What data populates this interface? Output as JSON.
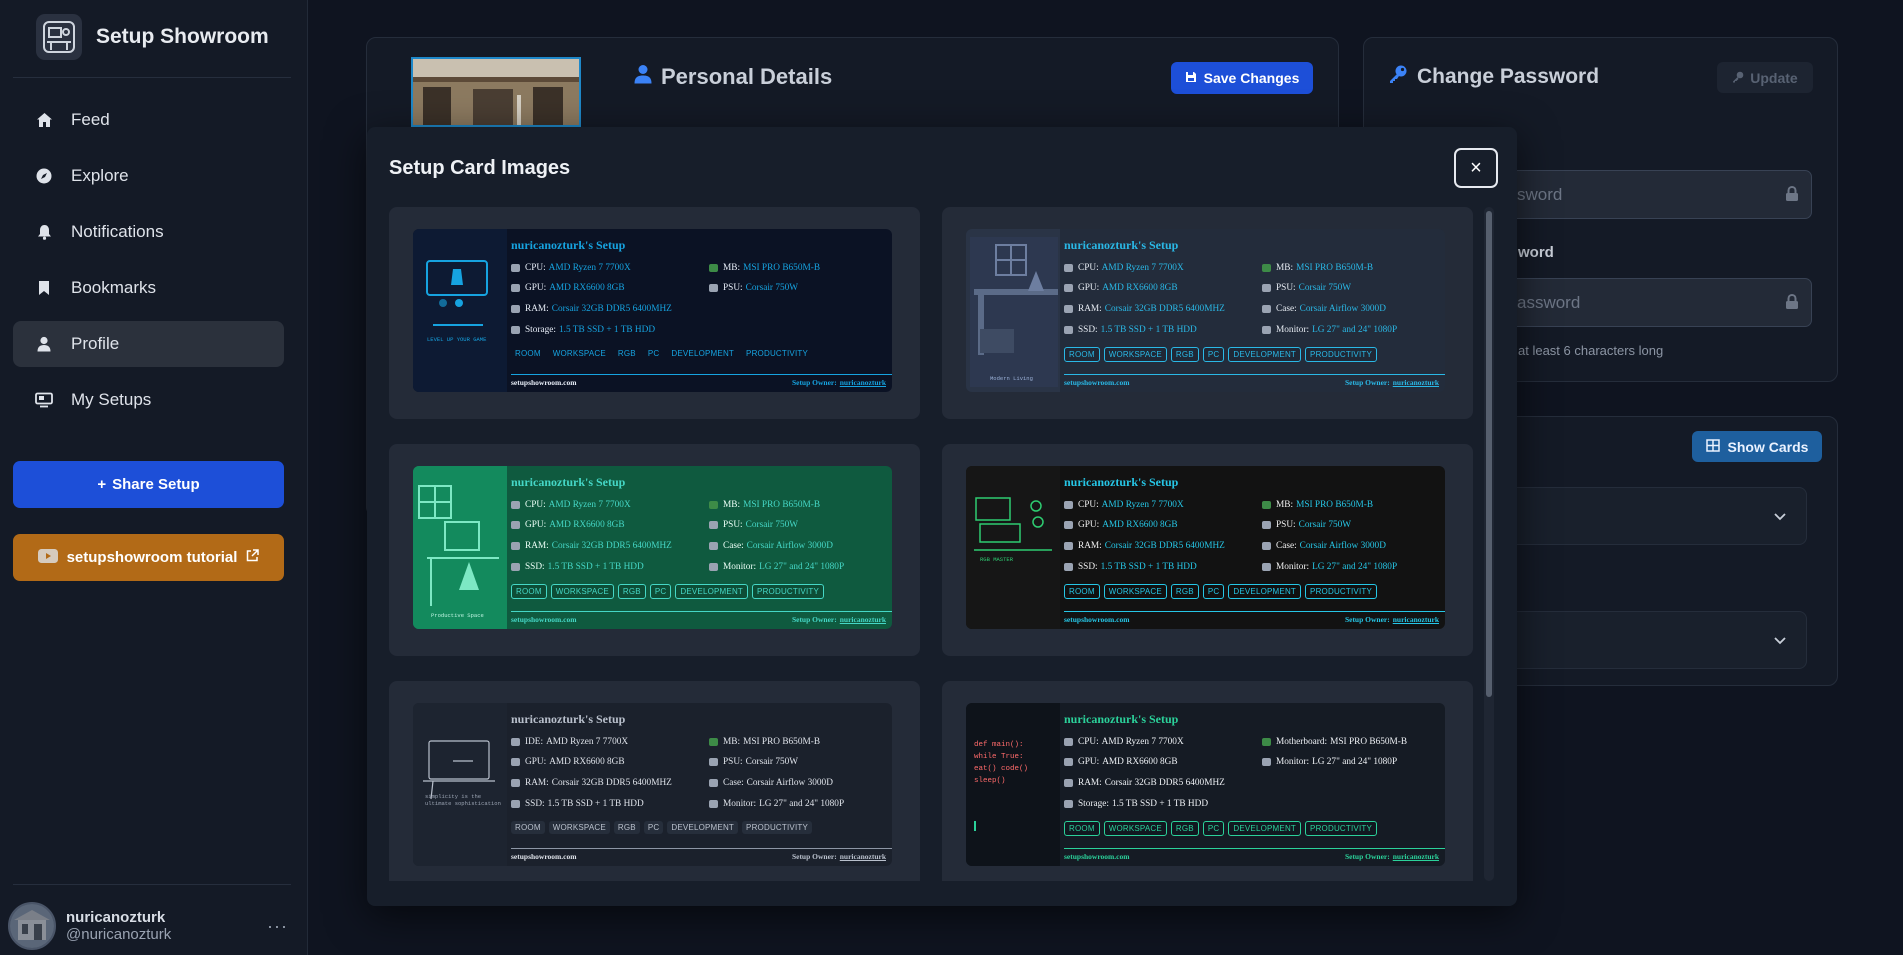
{
  "app": {
    "name": "Setup Showroom"
  },
  "sidebar": {
    "items": [
      {
        "label": "Feed",
        "icon": "home-icon"
      },
      {
        "label": "Explore",
        "icon": "compass-icon"
      },
      {
        "label": "Notifications",
        "icon": "bell-icon"
      },
      {
        "label": "Bookmarks",
        "icon": "bookmark-icon"
      },
      {
        "label": "Profile",
        "icon": "user-icon",
        "active": true
      },
      {
        "label": "My Setups",
        "icon": "monitor-icon"
      }
    ],
    "share_label": "Share Setup",
    "tutorial_label": "setupshowroom tutorial",
    "user": {
      "name": "nuricanozturk",
      "handle": "@nuricanozturk"
    }
  },
  "profile": {
    "personal_title": "Personal Details",
    "save_label": "Save Changes",
    "password_title": "Change Password",
    "update_label": "Update",
    "new_password_placeholder": "sword",
    "confirm_label": "word",
    "confirm_placeholder": "assword",
    "hint": "at least 6 characters long",
    "show_cards_label": "Show Cards"
  },
  "modal": {
    "title": "Setup Card Images",
    "close_label": "×",
    "cards": [
      {
        "theme": "dark-blue",
        "title": "nuricanozturk's Setup",
        "illustration_caption": "LEVEL UP YOUR GAME",
        "specs": [
          {
            "k": "CPU:",
            "v": "AMD Ryzen 7 7700X"
          },
          {
            "k": "MB:",
            "v": "MSI PRO B650M-B"
          },
          {
            "k": "GPU:",
            "v": "AMD RX6600 8GB"
          },
          {
            "k": "PSU:",
            "v": "Corsair 750W"
          },
          {
            "k": "RAM:",
            "v": "Corsair 32GB DDR5 6400MHZ"
          },
          {
            "k": "",
            "v": ""
          },
          {
            "k": "Storage:",
            "v": "1.5 TB SSD + 1 TB HDD"
          },
          {
            "k": "",
            "v": ""
          }
        ],
        "tags": [
          "ROOM",
          "WORKSPACE",
          "RGB",
          "PC",
          "DEVELOPMENT",
          "PRODUCTIVITY"
        ],
        "site": "setupshowroom.com",
        "owner_label": "Setup Owner:",
        "owner": "nuricanozturk"
      },
      {
        "theme": "slate",
        "title": "nuricanozturk's Setup",
        "illustration_caption": "Modern Living",
        "specs": [
          {
            "k": "CPU:",
            "v": "AMD Ryzen 7 7700X"
          },
          {
            "k": "MB:",
            "v": "MSI PRO B650M-B"
          },
          {
            "k": "GPU:",
            "v": "AMD RX6600 8GB"
          },
          {
            "k": "PSU:",
            "v": "Corsair 750W"
          },
          {
            "k": "RAM:",
            "v": "Corsair 32GB DDR5 6400MHZ"
          },
          {
            "k": "Case:",
            "v": "Corsair Airflow 3000D"
          },
          {
            "k": "SSD:",
            "v": "1.5 TB SSD + 1 TB HDD"
          },
          {
            "k": "Monitor:",
            "v": "LG 27\" and 24\" 1080P"
          }
        ],
        "tags": [
          "ROOM",
          "WORKSPACE",
          "RGB",
          "PC",
          "DEVELOPMENT",
          "PRODUCTIVITY"
        ],
        "site": "setupshowroom.com",
        "owner_label": "Setup Owner:",
        "owner": "nuricanozturk"
      },
      {
        "theme": "green",
        "title": "nuricanozturk's Setup",
        "illustration_caption": "Productive Space",
        "specs": [
          {
            "k": "CPU:",
            "v": "AMD Ryzen 7 7700X"
          },
          {
            "k": "MB:",
            "v": "MSI PRO B650M-B"
          },
          {
            "k": "GPU:",
            "v": "AMD RX6600 8GB"
          },
          {
            "k": "PSU:",
            "v": "Corsair 750W"
          },
          {
            "k": "RAM:",
            "v": "Corsair 32GB DDR5 6400MHZ"
          },
          {
            "k": "Case:",
            "v": "Corsair Airflow 3000D"
          },
          {
            "k": "SSD:",
            "v": "1.5 TB SSD + 1 TB HDD"
          },
          {
            "k": "Monitor:",
            "v": "LG 27\" and 24\" 1080P"
          }
        ],
        "tags": [
          "ROOM",
          "WORKSPACE",
          "RGB",
          "PC",
          "DEVELOPMENT",
          "PRODUCTIVITY"
        ],
        "site": "setupshowroom.com",
        "owner_label": "Setup Owner:",
        "owner": "nuricanozturk"
      },
      {
        "theme": "black",
        "title": "nuricanozturk's Setup",
        "illustration_caption": "RGB MASTER",
        "specs": [
          {
            "k": "CPU:",
            "v": "AMD Ryzen 7 7700X"
          },
          {
            "k": "MB:",
            "v": "MSI PRO B650M-B"
          },
          {
            "k": "GPU:",
            "v": "AMD RX6600 8GB"
          },
          {
            "k": "PSU:",
            "v": "Corsair 750W"
          },
          {
            "k": "RAM:",
            "v": "Corsair 32GB DDR5 6400MHZ"
          },
          {
            "k": "Case:",
            "v": "Corsair Airflow 3000D"
          },
          {
            "k": "SSD:",
            "v": "1.5 TB SSD + 1 TB HDD"
          },
          {
            "k": "Monitor:",
            "v": "LG 27\" and 24\" 1080P"
          }
        ],
        "tags": [
          "ROOM",
          "WORKSPACE",
          "RGB",
          "PC",
          "DEVELOPMENT",
          "PRODUCTIVITY"
        ],
        "site": "setupshowroom.com",
        "owner_label": "Setup Owner:",
        "owner": "nuricanozturk"
      },
      {
        "theme": "minimal",
        "title": "nuricanozturk's Setup",
        "illustration_caption": "simplicity is the ultimate sophistication",
        "specs": [
          {
            "k": "IDE:",
            "v": "AMD Ryzen 7 7700X"
          },
          {
            "k": "MB:",
            "v": "MSI PRO B650M-B"
          },
          {
            "k": "GPU:",
            "v": "AMD RX6600 8GB"
          },
          {
            "k": "PSU:",
            "v": "Corsair 750W"
          },
          {
            "k": "RAM:",
            "v": "Corsair 32GB DDR5 6400MHZ"
          },
          {
            "k": "Case:",
            "v": "Corsair Airflow 3000D"
          },
          {
            "k": "SSD:",
            "v": "1.5 TB SSD + 1 TB HDD"
          },
          {
            "k": "Monitor:",
            "v": "LG 27\" and 24\" 1080P"
          }
        ],
        "tags": [
          "ROOM",
          "WORKSPACE",
          "RGB",
          "PC",
          "DEVELOPMENT",
          "PRODUCTIVITY"
        ],
        "site": "setupshowroom.com",
        "owner_label": "Setup Owner:",
        "owner": "nuricanozturk"
      },
      {
        "theme": "code",
        "title": "nuricanozturk's Setup",
        "illustration_caption": "def main(): while True: eat() code() sleep()",
        "specs": [
          {
            "k": "CPU:",
            "v": "AMD Ryzen 7 7700X"
          },
          {
            "k": "Motherboard:",
            "v": "MSI PRO B650M-B"
          },
          {
            "k": "GPU:",
            "v": "AMD RX6600 8GB"
          },
          {
            "k": "Monitor:",
            "v": "LG 27\" and 24\" 1080P"
          },
          {
            "k": "RAM:",
            "v": "Corsair 32GB DDR5 6400MHZ"
          },
          {
            "k": "",
            "v": ""
          },
          {
            "k": "Storage:",
            "v": "1.5 TB SSD + 1 TB HDD"
          },
          {
            "k": "",
            "v": ""
          }
        ],
        "tags": [
          "ROOM",
          "WORKSPACE",
          "RGB",
          "PC",
          "DEVELOPMENT",
          "PRODUCTIVITY"
        ],
        "site": "setupshowroom.com",
        "owner_label": "Setup Owner:",
        "owner": "nuricanozturk"
      }
    ]
  }
}
